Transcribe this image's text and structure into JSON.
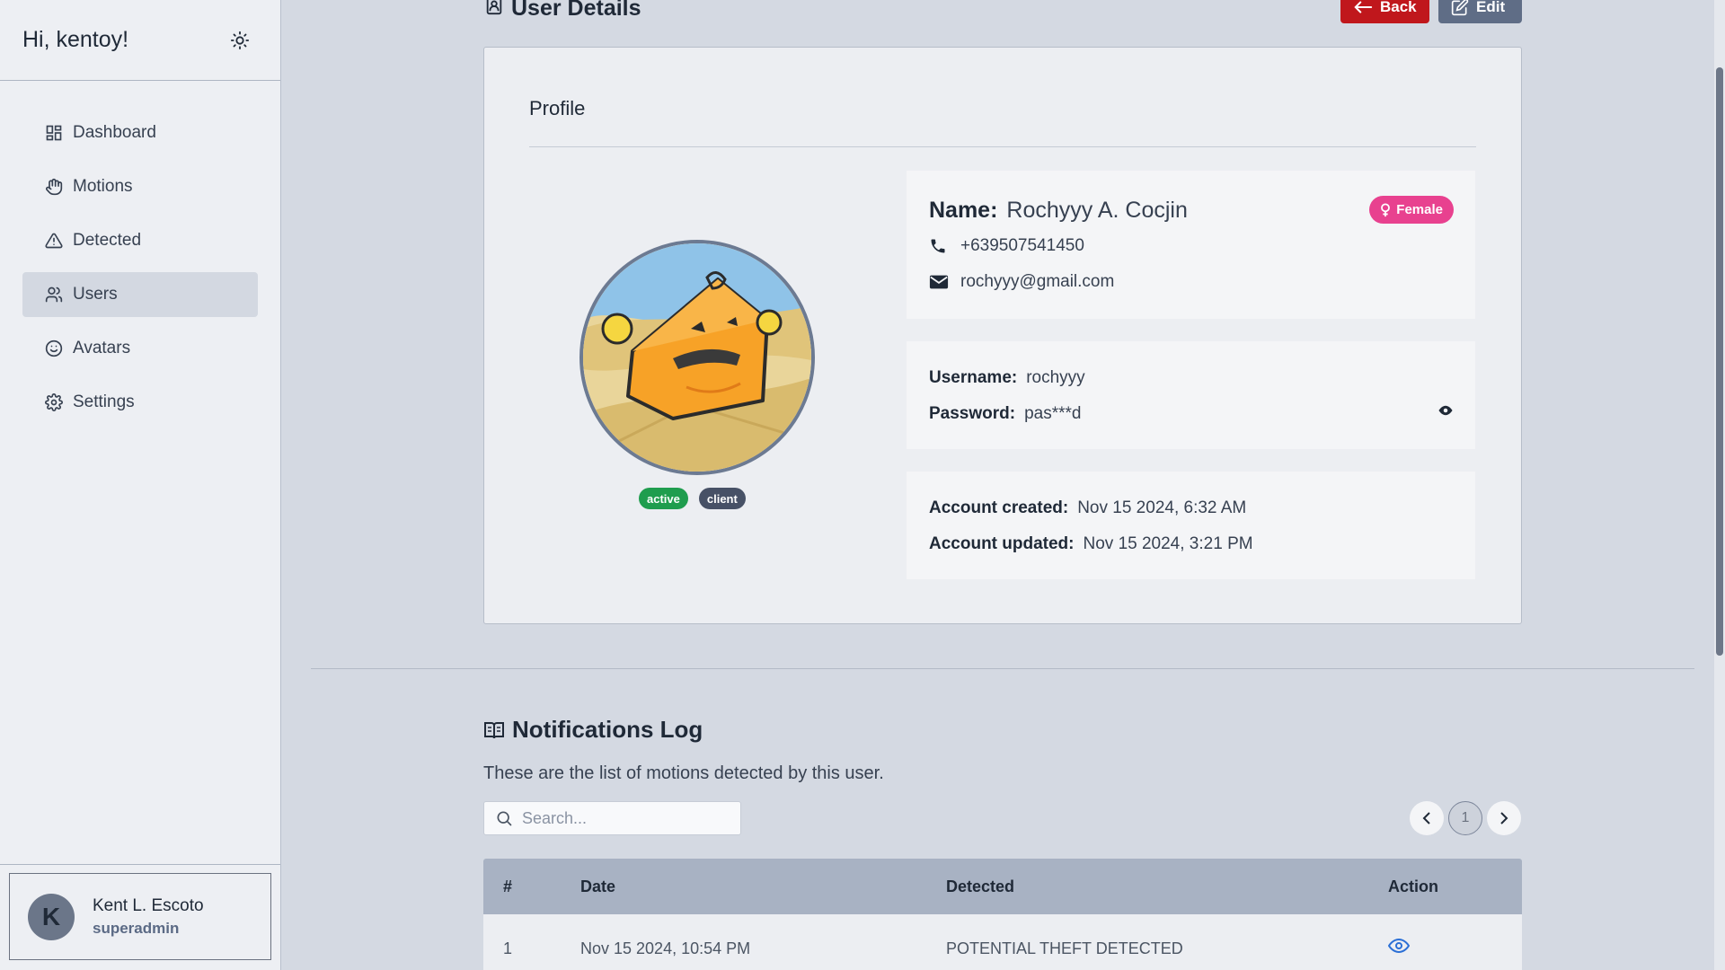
{
  "sidebar": {
    "greeting": "Hi, kentoy!",
    "theme_icon": "sun-icon",
    "items": [
      {
        "label": "Dashboard",
        "icon": "dashboard-grid-icon"
      },
      {
        "label": "Motions",
        "icon": "hand-icon"
      },
      {
        "label": "Detected",
        "icon": "warning-triangle-icon"
      },
      {
        "label": "Users",
        "icon": "users-icon",
        "active": true
      },
      {
        "label": "Avatars",
        "icon": "smile-icon"
      },
      {
        "label": "Settings",
        "icon": "gear-icon"
      }
    ],
    "footer": {
      "initial": "K",
      "name": "Kent L. Escoto",
      "role": "superadmin"
    }
  },
  "header": {
    "title": "User Details",
    "back_label": "Back",
    "edit_label": "Edit"
  },
  "profile": {
    "card_title": "Profile",
    "status_badges": [
      "active",
      "client"
    ],
    "name_label": "Name:",
    "name": "Rochyyy A. Cocjin",
    "gender": "Female",
    "phone": "+639507541450",
    "email": "rochyyy@gmail.com",
    "username_label": "Username:",
    "username": "rochyyy",
    "password_label": "Password:",
    "password": "pas***d",
    "created_label": "Account created:",
    "created": "Nov 15 2024, 6:32 AM",
    "updated_label": "Account updated:",
    "updated": "Nov 15 2024, 3:21 PM"
  },
  "notifications": {
    "title": "Notifications Log",
    "description": "These are the list of motions detected by this user.",
    "search_placeholder": "Search...",
    "current_page": "1",
    "columns": [
      "#",
      "Date",
      "Detected",
      "Action"
    ],
    "rows": [
      {
        "num": "1",
        "date": "Nov 15 2024, 10:54 PM",
        "detected": "POTENTIAL THEFT DETECTED"
      }
    ]
  },
  "colors": {
    "back_button": "#c0171c",
    "edit_button": "#5f6d86",
    "gender_badge": "#e8418f",
    "active_badge": "#1f9d4e",
    "client_badge": "#475166",
    "table_header": "#a8b2c3"
  }
}
